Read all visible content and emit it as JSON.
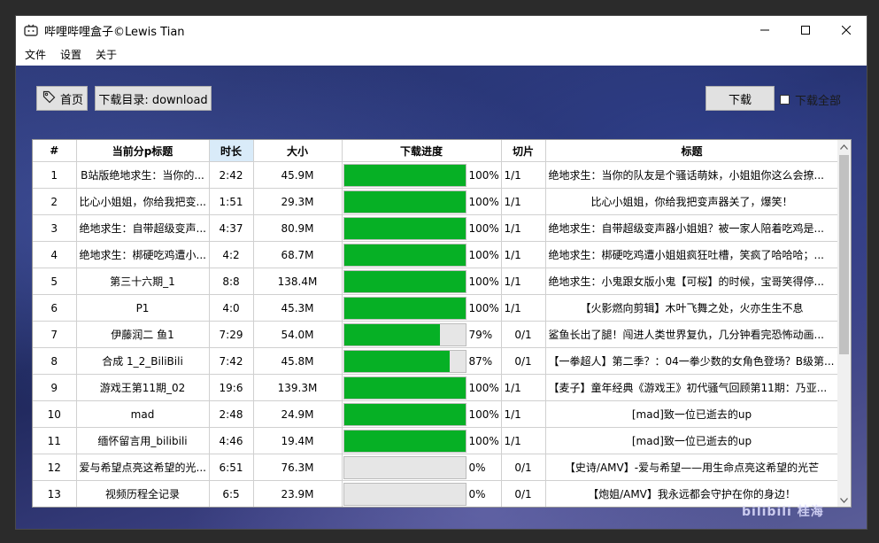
{
  "window": {
    "title": "哔哩哔哩盒子©Lewis Tian"
  },
  "menu": [
    "文件",
    "设置",
    "关于"
  ],
  "toolbar": {
    "home_label": "首页",
    "dir_label": "下载目录: download",
    "download_label": "下载",
    "download_all_label": "下载全部",
    "download_all_checked": false
  },
  "table": {
    "columns": [
      "#",
      "当前分p标题",
      "时长",
      "大小",
      "下载进度",
      "切片",
      "标题"
    ],
    "sorted_column": "时长",
    "rows": [
      {
        "num": "1",
        "part": "B站版绝地求生：当你的...",
        "dur": "2:42",
        "size": "45.9M",
        "progress": 1.0,
        "pct": "100%",
        "slice": "1/1",
        "title": "绝地求生：当你的队友是个骚话萌妹，小姐姐你这么会撩..."
      },
      {
        "num": "2",
        "part": "比心小姐姐，你给我把变...",
        "dur": "1:51",
        "size": "29.3M",
        "progress": 1.0,
        "pct": "100%",
        "slice": "1/1",
        "title": "比心小姐姐，你给我把变声器关了，爆笑！"
      },
      {
        "num": "3",
        "part": "绝地求生：自带超级变声...",
        "dur": "4:37",
        "size": "80.9M",
        "progress": 1.0,
        "pct": "100%",
        "slice": "1/1",
        "title": "绝地求生：自带超级变声器小姐姐？被一家人陪着吃鸡是..."
      },
      {
        "num": "4",
        "part": "绝地求生：梆硬吃鸡遭小...",
        "dur": "4:2",
        "size": "68.7M",
        "progress": 1.0,
        "pct": "100%",
        "slice": "1/1",
        "title": "绝地求生：梆硬吃鸡遭小姐姐疯狂吐槽，笑疯了哈哈哈；..."
      },
      {
        "num": "5",
        "part": "第三十六期_1",
        "dur": "8:8",
        "size": "138.4M",
        "progress": 1.0,
        "pct": "100%",
        "slice": "1/1",
        "title": "绝地求生：小鬼跟女版小鬼【可桜】的时候，宝哥笑得停..."
      },
      {
        "num": "6",
        "part": "P1",
        "dur": "4:0",
        "size": "45.3M",
        "progress": 1.0,
        "pct": "100%",
        "slice": "1/1",
        "title": "【火影燃向剪辑】木叶飞舞之处，火亦生生不息"
      },
      {
        "num": "7",
        "part": "伊藤润二 鱼1",
        "dur": "7:29",
        "size": "54.0M",
        "progress": 0.79,
        "pct": "79%",
        "slice": "0/1",
        "title": "鲨鱼长出了腿！闯进人类世界复仇，几分钟看完恐怖动画..."
      },
      {
        "num": "8",
        "part": "合成 1_2_BiliBili",
        "dur": "7:42",
        "size": "45.8M",
        "progress": 0.87,
        "pct": "87%",
        "slice": "0/1",
        "title": "【一拳超人】第二季？：04一拳少数的女角色登场？B级第..."
      },
      {
        "num": "9",
        "part": "游戏王第11期_02",
        "dur": "19:6",
        "size": "139.3M",
        "progress": 1.0,
        "pct": "100%",
        "slice": "1/1",
        "title": "【麦子】童年经典《游戏王》初代骚气回顾第11期：乃亚..."
      },
      {
        "num": "10",
        "part": "mad",
        "dur": "2:48",
        "size": "24.9M",
        "progress": 1.0,
        "pct": "100%",
        "slice": "1/1",
        "title": "[mad]致一位已逝去的up"
      },
      {
        "num": "11",
        "part": "缅怀留言用_bilibili",
        "dur": "4:46",
        "size": "19.4M",
        "progress": 1.0,
        "pct": "100%",
        "slice": "1/1",
        "title": "[mad]致一位已逝去的up"
      },
      {
        "num": "12",
        "part": "爱与希望点亮这希望的光...",
        "dur": "6:51",
        "size": "76.3M",
        "progress": 0.0,
        "pct": "0%",
        "slice": "0/1",
        "title": "【史诗/AMV】-爱与希望——用生命点亮这希望的光芒"
      },
      {
        "num": "13",
        "part": "视频历程全记录",
        "dur": "6:5",
        "size": "23.9M",
        "progress": 0.0,
        "pct": "0%",
        "slice": "0/1",
        "title": "【炮姐/AMV】我永远都会守护在你的身边！"
      }
    ]
  },
  "colors": {
    "progress_fill": "#06b025",
    "sorted_header": "#d9ebf9"
  },
  "watermark": "bilibili 桂海"
}
